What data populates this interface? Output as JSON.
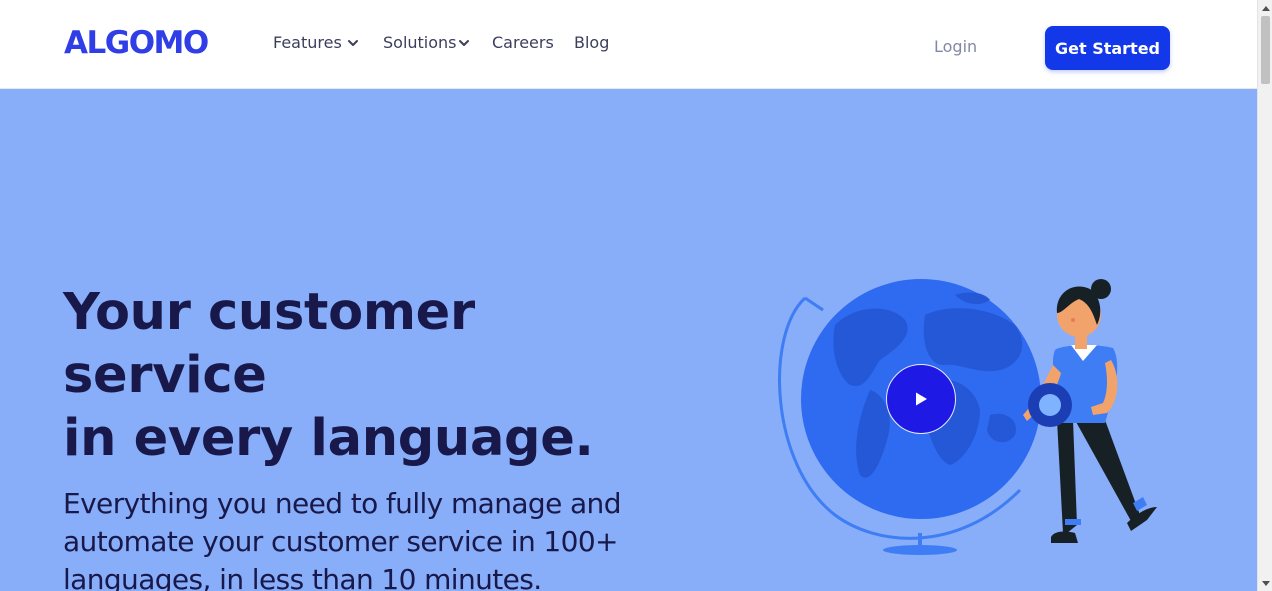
{
  "header": {
    "logo": "ALGOMO",
    "nav": [
      {
        "label": "Features",
        "has_dropdown": true
      },
      {
        "label": "Solutions",
        "has_dropdown": true
      },
      {
        "label": "Careers",
        "has_dropdown": false
      },
      {
        "label": "Blog",
        "has_dropdown": false
      }
    ],
    "login": "Login",
    "cta": "Get Started"
  },
  "hero": {
    "title_lines": [
      "Your customer",
      "service",
      "in every language."
    ],
    "subtitle": "Everything you need to fully manage and automate your customer service in 100+ languages, in less than 10 minutes.",
    "illustration": "woman-with-globe-illustration",
    "play_icon": "play-icon"
  },
  "colors": {
    "brand": "#2f3ee6",
    "cta_bg": "#1238ea",
    "hero_bg": "#88adf9",
    "heading": "#18194a",
    "globe": "#2f6bf0"
  }
}
